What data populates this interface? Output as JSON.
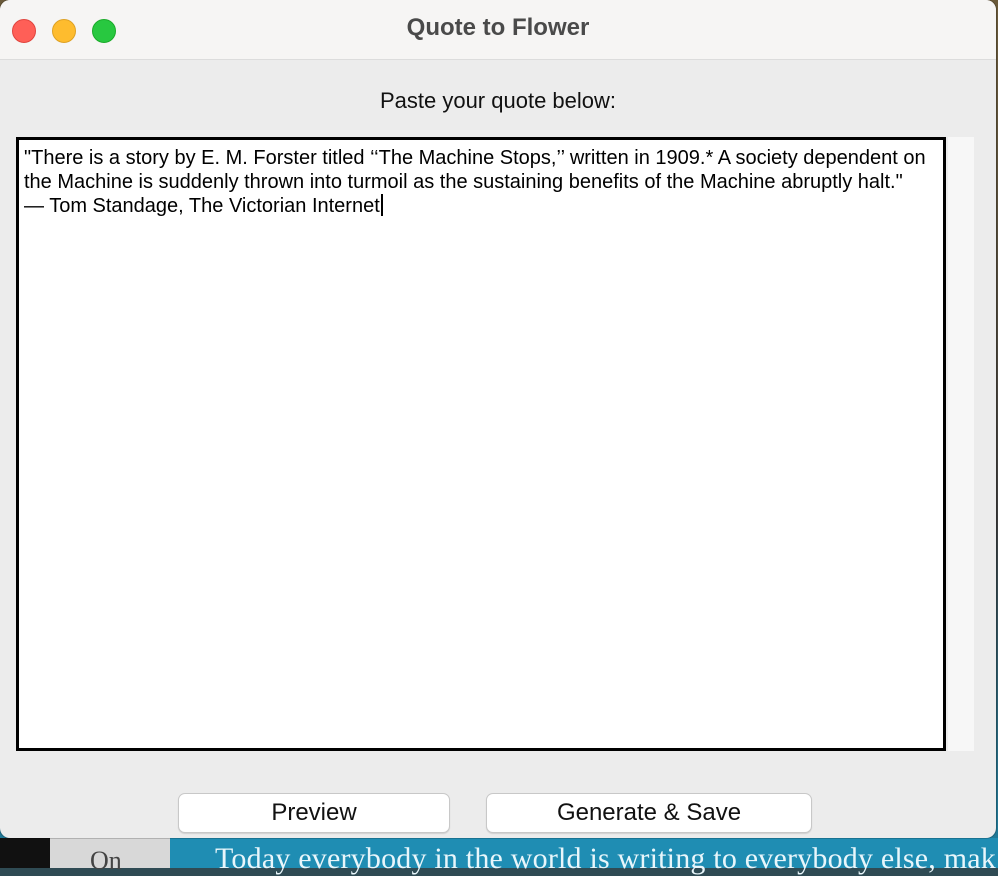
{
  "window": {
    "title": "Quote to Flower"
  },
  "prompt_label": "Paste your quote below:",
  "quote_text": "\"There is a story by E. M. Forster titled ‘‘The Machine Stops,’’ written in 1909.* A society dependent on the Machine is suddenly thrown into turmoil as the sustaining benefits of the Machine abruptly halt.\"\n— Tom Standage, The Victorian Internet",
  "buttons": {
    "preview": "Preview",
    "generate_save": "Generate & Save"
  },
  "background": {
    "partial_text": "Today everybody in the world is writing to everybody else, mak",
    "partial_left": "On"
  },
  "colors": {
    "close": "#ff5f57",
    "minimize": "#febc2e",
    "maximize": "#28c840"
  }
}
